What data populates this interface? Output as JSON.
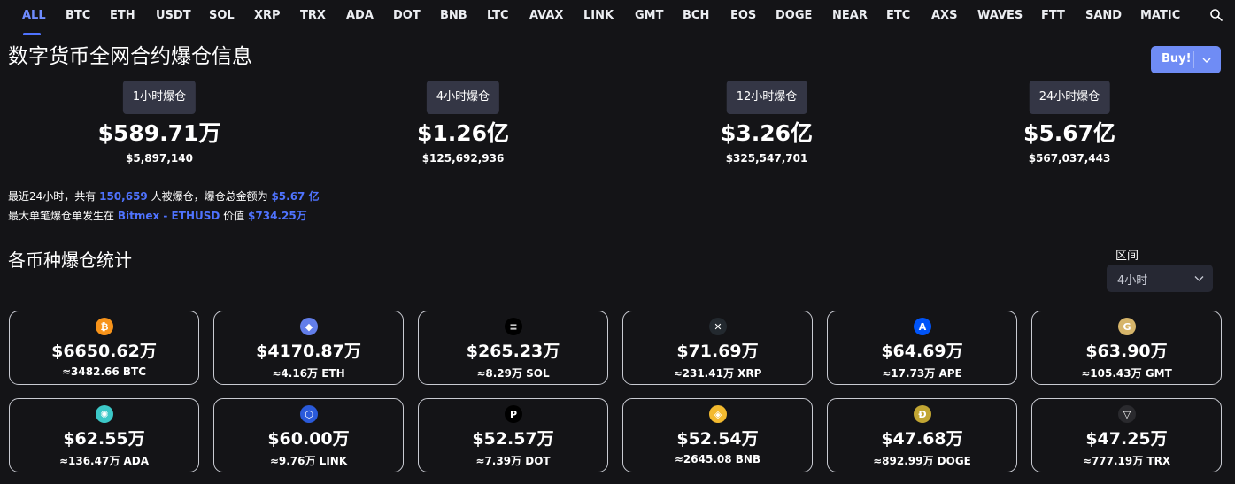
{
  "tabs": [
    "ALL",
    "BTC",
    "ETH",
    "USDT",
    "SOL",
    "XRP",
    "TRX",
    "ADA",
    "DOT",
    "BNB",
    "LTC",
    "AVAX",
    "LINK",
    "GMT",
    "BCH",
    "EOS",
    "DOGE",
    "NEAR",
    "ETC",
    "AXS",
    "WAVES",
    "FTT",
    "SAND",
    "MATIC"
  ],
  "active_tab": "ALL",
  "search_icon": "search-icon",
  "title": "数字货币全网合约爆仓信息",
  "buy": {
    "label": "Buy!",
    "icon": "chevron-down-icon"
  },
  "periods": [
    {
      "label": "1小时爆仓",
      "value": "$589.71万",
      "exact": "$5,897,140"
    },
    {
      "label": "4小时爆仓",
      "value": "$1.26亿",
      "exact": "$125,692,936"
    },
    {
      "label": "12小时爆仓",
      "value": "$3.26亿",
      "exact": "$325,547,701"
    },
    {
      "label": "24小时爆仓",
      "value": "$5.67亿",
      "exact": "$567,037,443"
    }
  ],
  "summary": {
    "line1_prefix": "最近24小时，共有",
    "people": "150,659",
    "line1_mid": "人被爆仓，爆仓总金额为",
    "total": "$5.67 亿",
    "line2_prefix": "最大单笔爆仓单发生在",
    "exchange": "Bitmex - ETHUSD",
    "line2_mid": "价值",
    "max_value": "$734.25万"
  },
  "section_title": "各币种爆仓统计",
  "range": {
    "label": "区间",
    "value": "4小时",
    "icon": "chevron-down-icon"
  },
  "coins": [
    {
      "symbol": "BTC",
      "amount": "$6650.62万",
      "qty": "≈3482.66 BTC",
      "icon": "btc-icon",
      "color": "#f7931a",
      "glyph": "₿"
    },
    {
      "symbol": "ETH",
      "amount": "$4170.87万",
      "qty": "≈4.16万 ETH",
      "icon": "eth-icon",
      "color": "#627eea",
      "glyph": "◆"
    },
    {
      "symbol": "SOL",
      "amount": "$265.23万",
      "qty": "≈8.29万 SOL",
      "icon": "sol-icon",
      "color": "#000000",
      "glyph": "≡"
    },
    {
      "symbol": "XRP",
      "amount": "$71.69万",
      "qty": "≈231.41万 XRP",
      "icon": "xrp-icon",
      "color": "#23292f",
      "glyph": "✕"
    },
    {
      "symbol": "APE",
      "amount": "$64.69万",
      "qty": "≈17.73万 APE",
      "icon": "ape-icon",
      "color": "#0054f9",
      "glyph": "A"
    },
    {
      "symbol": "GMT",
      "amount": "$63.90万",
      "qty": "≈105.43万 GMT",
      "icon": "gmt-icon",
      "color": "#d6b56a",
      "glyph": "G"
    },
    {
      "symbol": "ADA",
      "amount": "$62.55万",
      "qty": "≈136.47万 ADA",
      "icon": "ada-icon",
      "color": "#3cc8c8",
      "glyph": "✺"
    },
    {
      "symbol": "LINK",
      "amount": "$60.00万",
      "qty": "≈9.76万 LINK",
      "icon": "link-icon",
      "color": "#2a5ada",
      "glyph": "⬡"
    },
    {
      "symbol": "DOT",
      "amount": "$52.57万",
      "qty": "≈7.39万 DOT",
      "icon": "dot-icon",
      "color": "#000000",
      "glyph": "P"
    },
    {
      "symbol": "BNB",
      "amount": "$52.54万",
      "qty": "≈2645.08 BNB",
      "icon": "bnb-icon",
      "color": "#f3ba2f",
      "glyph": "◈"
    },
    {
      "symbol": "DOGE",
      "amount": "$47.68万",
      "qty": "≈892.99万 DOGE",
      "icon": "doge-icon",
      "color": "#c2a633",
      "glyph": "Ð"
    },
    {
      "symbol": "TRX",
      "amount": "$47.25万",
      "qty": "≈777.19万 TRX",
      "icon": "trx-icon",
      "color": "#2a2a2e",
      "glyph": "▽"
    }
  ]
}
